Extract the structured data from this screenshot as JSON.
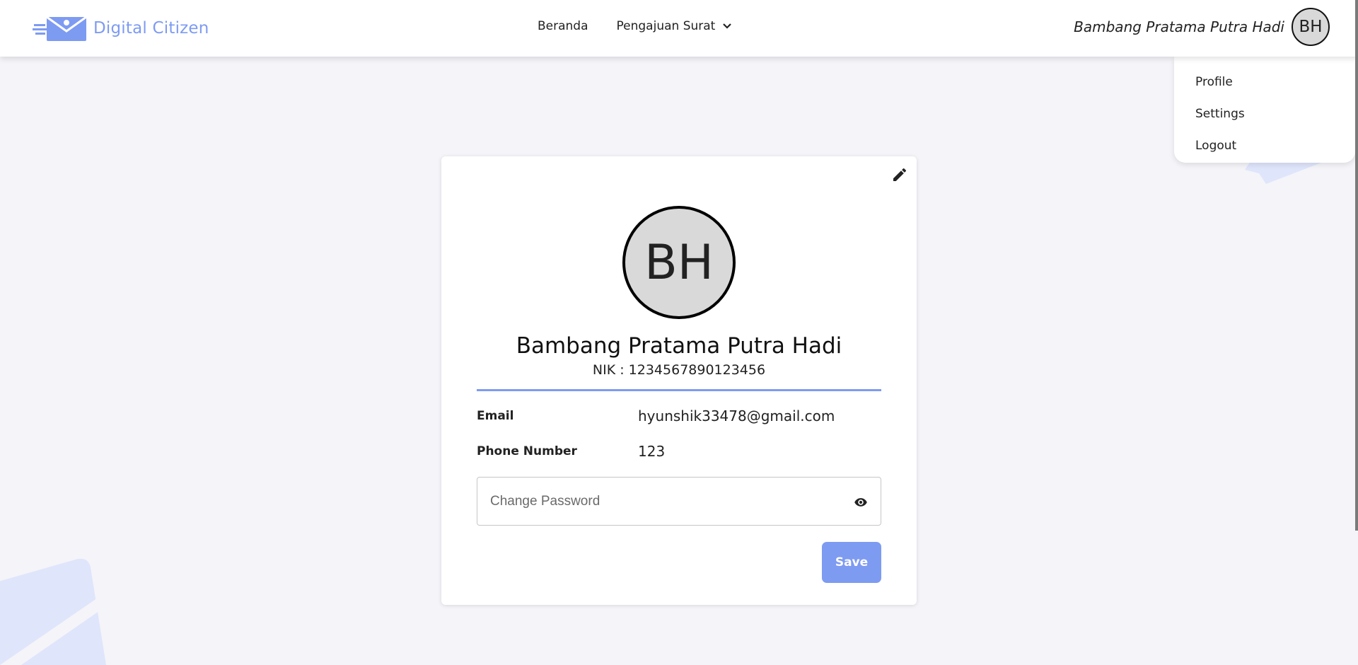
{
  "brand": {
    "name": "Digital Citizen",
    "logo_icon": "envelope-logo-icon"
  },
  "nav": {
    "items": [
      {
        "label": "Beranda"
      },
      {
        "label": "Pengajuan Surat",
        "icon": "chevron-down-icon"
      }
    ]
  },
  "user": {
    "name": "Bambang Pratama Putra Hadi",
    "initials": "BH"
  },
  "user_menu": {
    "items": [
      "Profile",
      "Settings",
      "Logout"
    ]
  },
  "profile": {
    "initials": "BH",
    "full_name": "Bambang Pratama Putra Hadi",
    "nik_text": "NIK : 1234567890123456",
    "fields": [
      {
        "label": "Email",
        "value": "hyunshik33478@gmail.com"
      },
      {
        "label": "Phone Number",
        "value": "123"
      }
    ],
    "password_placeholder": "Change Password",
    "save_label": "Save",
    "edit_icon": "pencil-icon",
    "visibility_icon": "eye-icon"
  },
  "colors": {
    "accent": "#7e9bf2",
    "background": "#f4f4f9",
    "decoration": "#dfe5fb"
  }
}
